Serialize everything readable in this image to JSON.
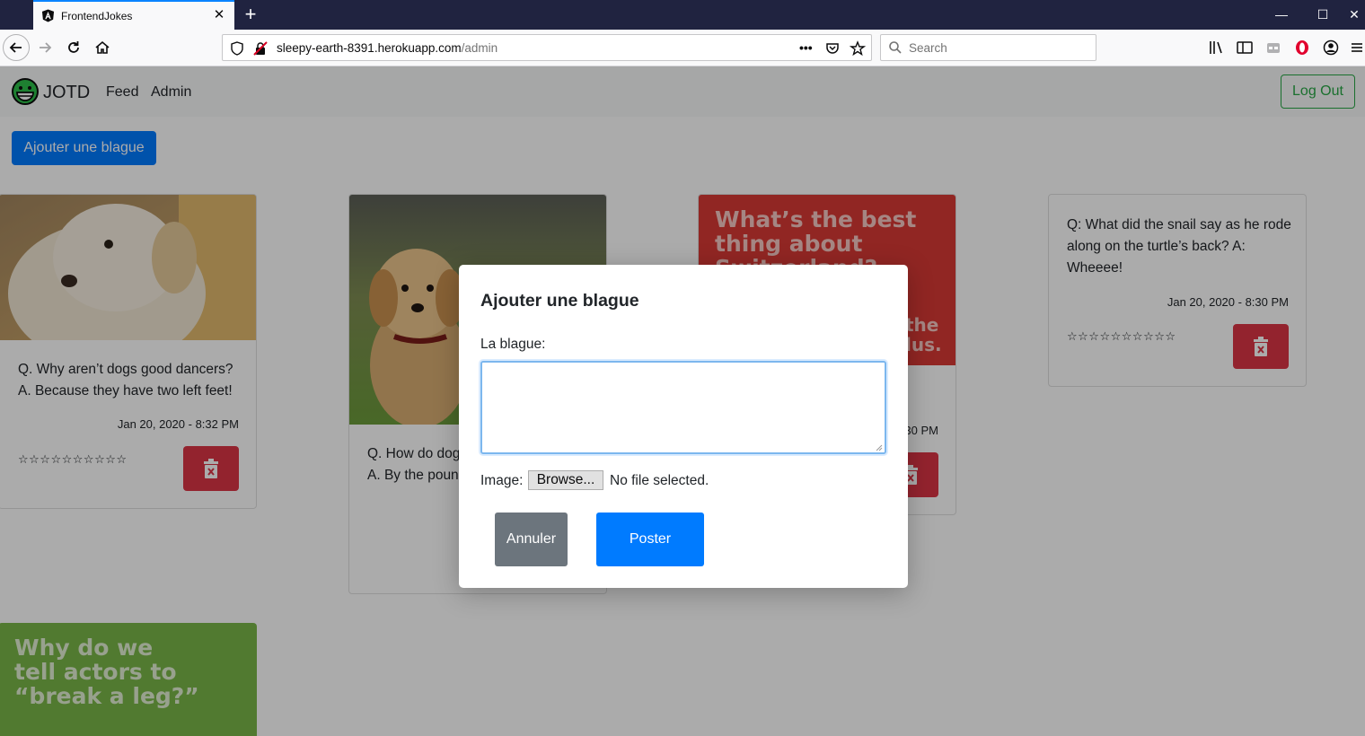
{
  "browser": {
    "tab_title": "FrontendJokes",
    "url_domain": "sleepy-earth-8391.herokuapp.com",
    "url_path": "/admin",
    "search_placeholder": "Search",
    "url_actions_label": "•••"
  },
  "app": {
    "brand": "JOTD",
    "nav": [
      "Feed",
      "Admin"
    ],
    "logout_label": "Log Out",
    "add_button_label": "Ajouter une blague"
  },
  "cards": [
    {
      "text_line1": "Q. Why aren’t dogs good dancers?",
      "text_line2": "A. Because they have two left feet!",
      "date": "Jan 20, 2020 - 8:32 PM",
      "stars": "☆☆☆☆☆☆☆☆☆☆"
    },
    {
      "text_line1": "Q. How do dog",
      "text_line2": "A. By the poun",
      "stars": "☆☆☆☆☆☆☆☆"
    },
    {
      "image_text": [
        "What’s the best",
        "thing about",
        "Switzerland?"
      ],
      "image_text_tail": [
        "the",
        "lus."
      ],
      "date": "30 PM"
    },
    {
      "text": "Q: What did the snail say as he rode along on the turtle’s back? A: Wheeee!",
      "date": "Jan 20, 2020 - 8:30 PM",
      "stars": "☆☆☆☆☆☆☆☆☆☆"
    },
    {
      "image_text": [
        "Why do we",
        "tell actors to",
        "“break a leg?”"
      ]
    }
  ],
  "modal": {
    "title": "Ajouter une blague",
    "joke_label": "La blague:",
    "joke_value": "",
    "image_label": "Image:",
    "browse_label": "Browse...",
    "file_status": "No file selected.",
    "cancel_label": "Annuler",
    "submit_label": "Poster"
  },
  "colors": {
    "primary": "#007bff",
    "danger": "#dc3545",
    "success": "#28a745",
    "secondary": "#6c757d",
    "red_card": "#d93a35",
    "green_card": "#7ab648",
    "tabbar": "#202340"
  }
}
